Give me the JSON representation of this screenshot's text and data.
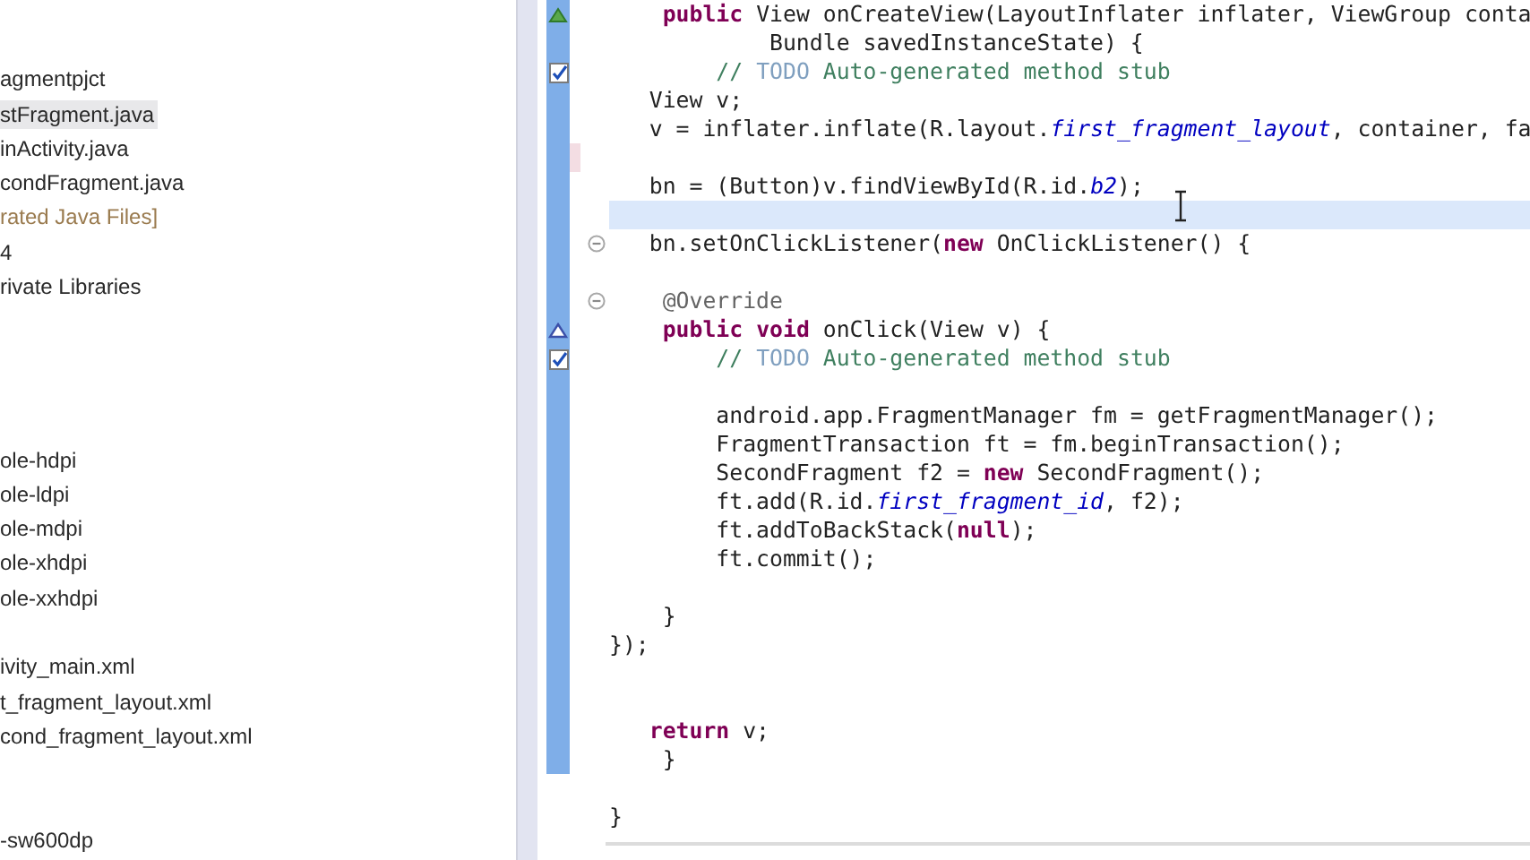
{
  "project_tree": {
    "items": [
      {
        "kind": "hidden",
        "selected": false
      },
      {
        "kind": "hidden",
        "selected": false
      },
      {
        "kind": "file",
        "label": "agmentpjct",
        "selected": false
      },
      {
        "kind": "file",
        "label": "stFragment.java",
        "selected": true
      },
      {
        "kind": "file",
        "label": "inActivity.java",
        "selected": false
      },
      {
        "kind": "file",
        "label": "condFragment.java",
        "selected": false
      },
      {
        "kind": "generated",
        "label": "rated Java Files]",
        "selected": false
      },
      {
        "kind": "file",
        "label": "4",
        "selected": false
      },
      {
        "kind": "file",
        "label": "rivate Libraries",
        "selected": false
      },
      {
        "kind": "hidden",
        "selected": false
      },
      {
        "kind": "hidden",
        "selected": false
      },
      {
        "kind": "hidden",
        "selected": false
      },
      {
        "kind": "hidden",
        "selected": false
      },
      {
        "kind": "file",
        "label": "ole-hdpi",
        "selected": false
      },
      {
        "kind": "file",
        "label": "ole-ldpi",
        "selected": false
      },
      {
        "kind": "file",
        "label": "ole-mdpi",
        "selected": false
      },
      {
        "kind": "file",
        "label": "ole-xhdpi",
        "selected": false
      },
      {
        "kind": "file",
        "label": "ole-xxhdpi",
        "selected": false
      },
      {
        "kind": "hidden",
        "selected": false
      },
      {
        "kind": "file",
        "label": "ivity_main.xml",
        "selected": false
      },
      {
        "kind": "file",
        "label": "t_fragment_layout.xml",
        "selected": false
      },
      {
        "kind": "file",
        "label": "cond_fragment_layout.xml",
        "selected": false
      },
      {
        "kind": "hidden",
        "selected": false
      },
      {
        "kind": "hidden",
        "selected": false
      },
      {
        "kind": "file",
        "label": "-sw600dp",
        "selected": false
      }
    ]
  },
  "editor": {
    "blocks": [
      {
        "kind": "range",
        "lines": [
          {
            "kind": "code",
            "current": false,
            "marker": {
              "kind": "implements"
            },
            "segments": [
              {
                "text": "    public",
                "kind": "keyword"
              },
              {
                "text": " View onCreateView(LayoutInflater inflater, ViewGroup conta"
              }
            ]
          },
          {
            "kind": "code",
            "current": false,
            "segments": [
              {
                "text": "            Bundle savedInstanceState) {"
              }
            ]
          },
          {
            "kind": "code",
            "current": false,
            "marker": {
              "kind": "task"
            },
            "segments": [
              {
                "text": "        // ",
                "kind": "comment"
              },
              {
                "text": "TODO",
                "kind": "task"
              },
              {
                "text": " Auto-generated method stub",
                "kind": "comment"
              }
            ]
          },
          {
            "kind": "code",
            "current": false,
            "segments": [
              {
                "text": "   View v;"
              }
            ]
          },
          {
            "kind": "code",
            "current": false,
            "segments": [
              {
                "text": "   v = inflater.inflate(R.layout."
              },
              {
                "text": "first_fragment_layout",
                "kind": "field"
              },
              {
                "text": ", container, fa"
              }
            ]
          },
          {
            "kind": "blank",
            "current": false,
            "marker": {
              "kind": "change"
            }
          },
          {
            "kind": "code",
            "current": false,
            "segments": [
              {
                "text": "   bn = (Button)v.findViewById(R.id."
              },
              {
                "text": "b2",
                "kind": "field"
              },
              {
                "text": ");"
              }
            ]
          },
          {
            "kind": "blank",
            "current": true
          },
          {
            "kind": "code",
            "current": false,
            "marker": {
              "kind": "fold"
            },
            "segments": [
              {
                "text": "   bn.setOnClickListener("
              },
              {
                "text": "new",
                "kind": "keyword"
              },
              {
                "text": " OnClickListener() {"
              }
            ]
          },
          {
            "kind": "blank",
            "current": false
          },
          {
            "kind": "code",
            "current": false,
            "marker": {
              "kind": "fold"
            },
            "segments": [
              {
                "text": "    @Override",
                "kind": "annotation"
              }
            ]
          },
          {
            "kind": "code",
            "current": false,
            "marker": {
              "kind": "override"
            },
            "segments": [
              {
                "text": "    public",
                "kind": "keyword"
              },
              {
                "text": " void",
                "kind": "keyword"
              },
              {
                "text": " onClick(View v) {"
              }
            ]
          },
          {
            "kind": "code",
            "current": false,
            "marker": {
              "kind": "task"
            },
            "segments": [
              {
                "text": "        // ",
                "kind": "comment"
              },
              {
                "text": "TODO",
                "kind": "task"
              },
              {
                "text": " Auto-generated method stub",
                "kind": "comment"
              }
            ]
          },
          {
            "kind": "blank",
            "current": false
          },
          {
            "kind": "code",
            "current": false,
            "segments": [
              {
                "text": "        android.app.FragmentManager fm = getFragmentManager();"
              }
            ]
          },
          {
            "kind": "code",
            "current": false,
            "segments": [
              {
                "text": "        FragmentTransaction ft = fm.beginTransaction();"
              }
            ]
          },
          {
            "kind": "code",
            "current": false,
            "segments": [
              {
                "text": "        SecondFragment f2 = "
              },
              {
                "text": "new",
                "kind": "keyword"
              },
              {
                "text": " SecondFragment();"
              }
            ]
          },
          {
            "kind": "code",
            "current": false,
            "segments": [
              {
                "text": "        ft.add(R.id."
              },
              {
                "text": "first_fragment_id",
                "kind": "field"
              },
              {
                "text": ", f2);"
              }
            ]
          },
          {
            "kind": "code",
            "current": false,
            "segments": [
              {
                "text": "        ft.addToBackStack("
              },
              {
                "text": "null",
                "kind": "keyword"
              },
              {
                "text": ");"
              }
            ]
          },
          {
            "kind": "code",
            "current": false,
            "segments": [
              {
                "text": "        ft.commit();"
              }
            ]
          },
          {
            "kind": "blank",
            "current": false
          },
          {
            "kind": "code",
            "current": false,
            "segments": [
              {
                "text": "    }"
              }
            ]
          },
          {
            "kind": "code",
            "current": false,
            "segments": [
              {
                "text": "});"
              }
            ]
          },
          {
            "kind": "blank",
            "current": false
          },
          {
            "kind": "blank",
            "current": false
          },
          {
            "kind": "code",
            "current": false,
            "segments": [
              {
                "text": "   return",
                "kind": "keyword"
              },
              {
                "text": " v;"
              }
            ]
          },
          {
            "kind": "code",
            "current": false,
            "segments": [
              {
                "text": "    }"
              }
            ]
          }
        ]
      },
      {
        "kind": "plain",
        "lines": [
          {
            "kind": "blank",
            "current": false
          },
          {
            "kind": "code",
            "current": false,
            "segments": [
              {
                "text": "}"
              }
            ]
          }
        ]
      }
    ]
  }
}
